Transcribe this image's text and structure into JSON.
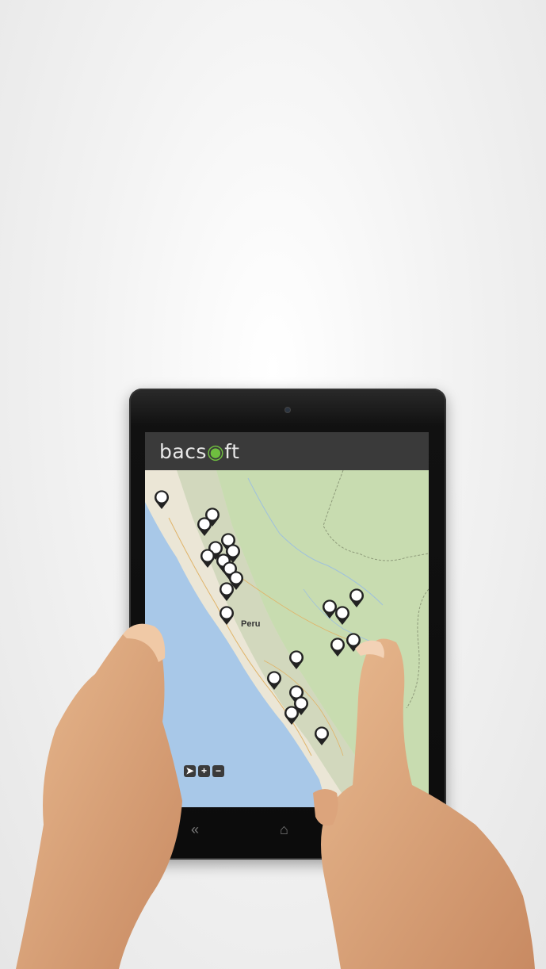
{
  "app": {
    "logo_text_a": "bacs",
    "logo_text_b": "ft"
  },
  "map": {
    "country_label": "Peru",
    "controls": {
      "locate_icon": "navigation-arrow-icon",
      "zoom_in_label": "+",
      "zoom_out_label": "−"
    },
    "marker_icon": "map-pin-icon",
    "marker_count": 28
  },
  "device_nav": {
    "back_icon": "double-chevron-left-icon",
    "back_label": "«",
    "home_icon": "home-icon",
    "home_label": "⌂",
    "recent_icon": "recent-apps-icon"
  },
  "colors": {
    "header_bg": "#3a3a3a",
    "logo_accent": "#6fbf3f",
    "ocean": "#a8c8e8",
    "land": "#dfe6cf",
    "jungle": "#c8dcb0"
  }
}
